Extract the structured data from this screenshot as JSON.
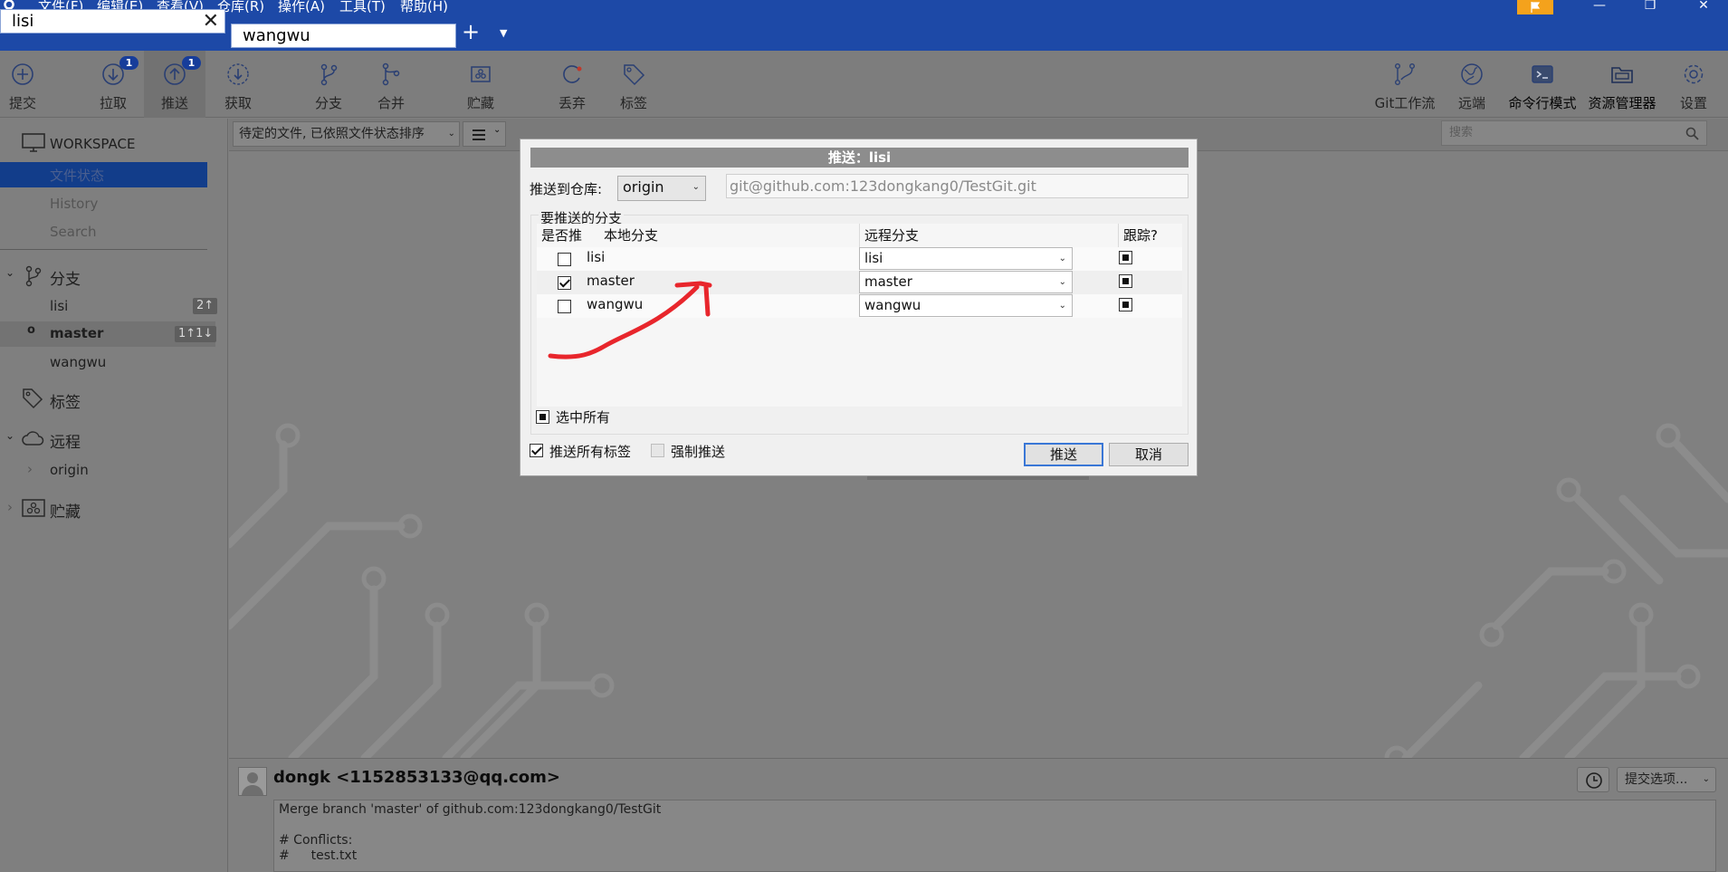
{
  "menus": [
    "文件(F)",
    "编辑(E)",
    "查看(V)",
    "仓库(R)",
    "操作(A)",
    "工具(T)",
    "帮助(H)"
  ],
  "tabs": [
    {
      "label": "lisi",
      "close": "✕"
    },
    {
      "label": "wangwu"
    }
  ],
  "tab_add": "+",
  "toolbar": {
    "commit": "提交",
    "pull": "拉取",
    "pull_badge": "1",
    "push": "推送",
    "push_badge": "1",
    "fetch": "获取",
    "branch": "分支",
    "merge": "合并",
    "stash": "贮藏",
    "discard": "丢弃",
    "tag": "标签",
    "gitflow": "Git工作流",
    "remote": "远端",
    "terminal": "命令行模式",
    "explorer": "资源管理器",
    "settings": "设置"
  },
  "sidebar": {
    "workspace": "WORKSPACE",
    "ws_items": [
      "文件状态",
      "History",
      "Search"
    ],
    "branches_header": "分支",
    "branches": [
      {
        "name": "lisi",
        "count": "2↑"
      },
      {
        "name": "master",
        "count": "1↑1↓"
      },
      {
        "name": "wangwu",
        "count": ""
      }
    ],
    "tags_header": "标签",
    "remotes_header": "远程",
    "remote_origin": "origin",
    "stash_header": "贮藏"
  },
  "main": {
    "sort": "待定的文件, 已依照文件状态排序",
    "search_placeholder": "搜索"
  },
  "commit": {
    "author": "dongk <1152853133@qq.com>",
    "options": "提交选项...",
    "message": "Merge branch 'master' of github.com:123dongkang0/TestGit\n\n# Conflicts:\n#\ttest.txt"
  },
  "dialog": {
    "title": "推送：lisi",
    "repo_label": "推送到仓库:",
    "repo_value": "origin",
    "repo_url": "git@github.com:123dongkang0/TestGit.git",
    "group_label": "要推送的分支",
    "headers": {
      "push": "是否推",
      "local": "本地分支",
      "remote": "远程分支",
      "track": "跟踪?"
    },
    "rows": [
      {
        "push": false,
        "local": "lisi",
        "remote": "lisi",
        "track": true
      },
      {
        "push": true,
        "local": "master",
        "remote": "master",
        "track": true
      },
      {
        "push": false,
        "local": "wangwu",
        "remote": "wangwu",
        "track": true
      }
    ],
    "select_all": "选中所有",
    "push_all_tags": "推送所有标签",
    "force_push": "强制推送",
    "push_button": "推送",
    "cancel_button": "取消"
  },
  "colors": {
    "accent": "#1d49a7",
    "selection": "#123d8a",
    "annotation": "#e8262c",
    "overlay": "#7f7f7f"
  }
}
